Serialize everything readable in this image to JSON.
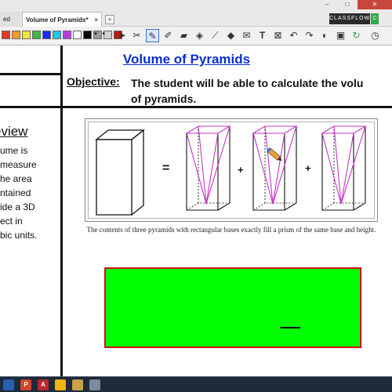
{
  "browser": {
    "prev_tab_label": "ed",
    "active_tab_label": "Volume of Pyramids*",
    "brand": "CLASSFLOW",
    "brand_badge": "C",
    "window": {
      "minimize": "–",
      "maximize": "□",
      "close": "✕"
    }
  },
  "toolbar": {
    "swatch_colors": [
      "#e23a2a",
      "#f39a2a",
      "#f2e531",
      "#40b84a",
      "#1a2aff",
      "#22c7e8",
      "#b83ee0",
      "#ffffff",
      "#000000",
      "#9a9a9a",
      "#d2d2d2",
      "#c21818"
    ],
    "tool_icons": [
      "cursor-icon",
      "tools-icon",
      "pen-icon",
      "highlighter-icon",
      "eraser-icon",
      "fill-icon",
      "line-icon",
      "shape-icon",
      "stamp-icon",
      "text-icon",
      "delete-icon",
      "undo-icon",
      "redo-icon",
      "color-icon",
      "clock-icon"
    ]
  },
  "lesson": {
    "title": "Volume of Pyramids",
    "objective_label": "Objective:",
    "objective_line1": "The student will be able to calculate the volu",
    "objective_line2": "of pyramids.",
    "review_heading": "eview",
    "review_lines": [
      "ume is",
      "measure",
      "he area",
      "ntained",
      "ide a 3D",
      "ect in",
      "bic units."
    ],
    "equals": "=",
    "plus1": "+",
    "plus2": "+",
    "caption": "The contents of three pyramids with rectangular bases exactly fill a prism of the same base and height.",
    "answer_dash": "—"
  },
  "taskbar": {
    "items": [
      {
        "label": "",
        "color": "#2a5fb0"
      },
      {
        "label": "P",
        "color": "#d24726"
      },
      {
        "label": "A",
        "color": "#b7282e"
      },
      {
        "label": "",
        "color": "#f2b40d"
      },
      {
        "label": "",
        "color": "#c9a24a"
      },
      {
        "label": "",
        "color": "#7a8aa0"
      }
    ]
  }
}
